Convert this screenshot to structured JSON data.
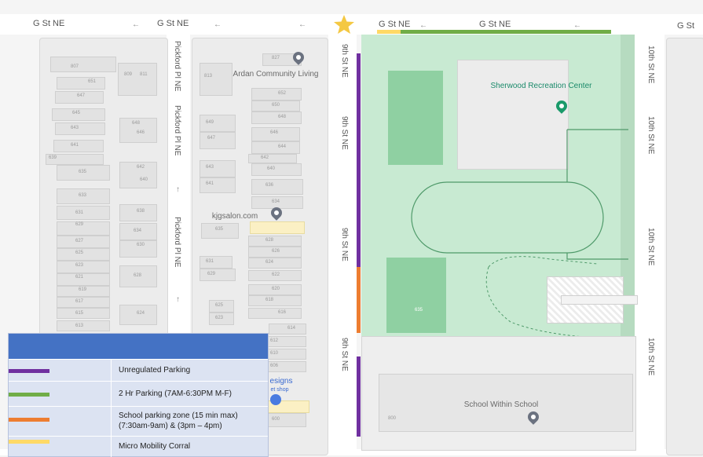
{
  "streets": {
    "g_st_1": "G St NE",
    "g_st_2": "G St NE",
    "g_st_3": "G St NE",
    "g_st_4": "G St NE",
    "g_st_5": "G St",
    "pickford_1": "Pickford Pl NE",
    "pickford_2": "Pickford Pl NE",
    "pickford_3": "Pickford Pl NE",
    "ninth_1": "9th St NE",
    "ninth_2": "9th St NE",
    "ninth_3": "9th St NE",
    "ninth_4": "9th St NE",
    "tenth_1": "10th St NE",
    "tenth_2": "10th St NE",
    "tenth_3": "10th St NE",
    "tenth_4": "10th St NE"
  },
  "pois": {
    "ardan": "Ardan Community Living",
    "sherwood": "Sherwood Recreation Center",
    "kjg": "kjgsalon.com",
    "school": "School Within School",
    "designs": "esigns",
    "designs_sub": "et shop"
  },
  "house_numbers": {
    "left_col": [
      "807",
      "651",
      "647",
      "645",
      "643",
      "641",
      "639",
      "635",
      "633",
      "631",
      "629",
      "627",
      "625",
      "623",
      "621",
      "619",
      "617",
      "615",
      "613"
    ],
    "mid_col": [
      "809",
      "811",
      "648",
      "646",
      "642",
      "640",
      "638",
      "634",
      "630",
      "628",
      "624"
    ],
    "right_col_a": [
      "813",
      "649",
      "647",
      "643",
      "641",
      "635",
      "631",
      "629",
      "625",
      "623"
    ],
    "right_col_b": [
      "827",
      "652",
      "650",
      "648",
      "646",
      "644",
      "642",
      "640",
      "636",
      "634",
      "628",
      "626",
      "624",
      "622",
      "620",
      "618",
      "616",
      "614",
      "612",
      "610",
      "606",
      "600"
    ],
    "park_num": "635",
    "school_num": "800"
  },
  "legend": {
    "items": [
      {
        "label": "Unregulated Parking",
        "color": "#7030a0"
      },
      {
        "label": "2 Hr Parking (7AM-6:30PM M-F)",
        "color": "#70ad47"
      },
      {
        "label": "School parking zone (15 min max) (7:30am-9am) & (3pm – 4pm)",
        "color": "#ed7d31"
      },
      {
        "label": "Micro Mobility Corral",
        "color": "#ffd966"
      }
    ]
  },
  "colors": {
    "unregulated": "#7030a0",
    "two_hr": "#70ad47",
    "school": "#ed7d31",
    "corral": "#ffd966",
    "star": "#f4c842"
  },
  "icons": {
    "star": "star-icon",
    "pins": "map-pin-icon"
  }
}
